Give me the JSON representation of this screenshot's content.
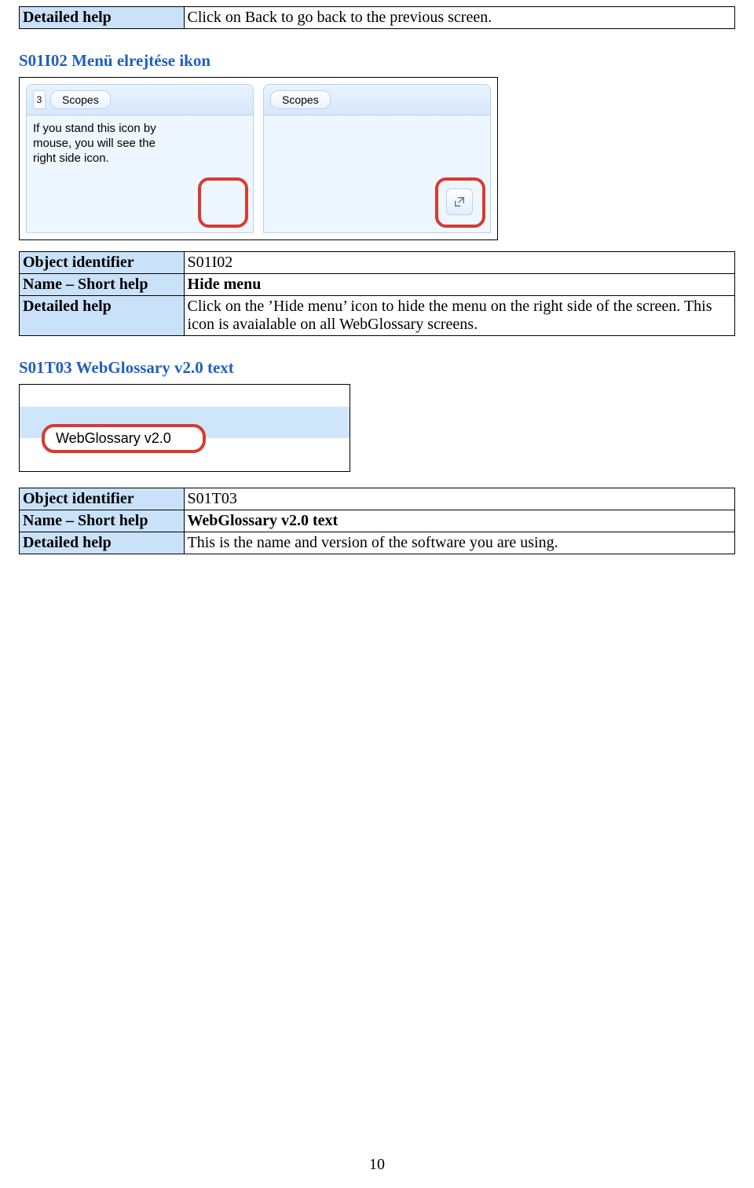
{
  "top_table": {
    "label": "Detailed help",
    "value": "Click on Back to go back to the previous screen."
  },
  "section1": {
    "heading": "S01I02 Menü elrejtése ikon",
    "fig": {
      "leftnum": "3",
      "scopes_btn": "Scopes",
      "hint_text": "If you stand this icon by\nmouse, you will see the\nright side icon."
    },
    "table": {
      "r1_label": "Object identifier",
      "r1_value": "S01I02",
      "r2_label": "Name – Short help",
      "r2_value": "Hide menu",
      "r3_label": "Detailed help",
      "r3_value": "Click on the ’Hide menu’ icon to hide the menu on the right side of the screen. This icon is avaialable on all WebGlossary screens."
    }
  },
  "section2": {
    "heading": "S01T03 WebGlossary v2.0 text",
    "fig_label": "WebGlossary v2.0",
    "table": {
      "r1_label": "Object identifier",
      "r1_value": "S01T03",
      "r2_label": "Name – Short help",
      "r2_value": "WebGlossary v2.0 text",
      "r3_label": "Detailed help",
      "r3_value": "This is the name and version of the software you are using."
    }
  },
  "page_number": "10"
}
